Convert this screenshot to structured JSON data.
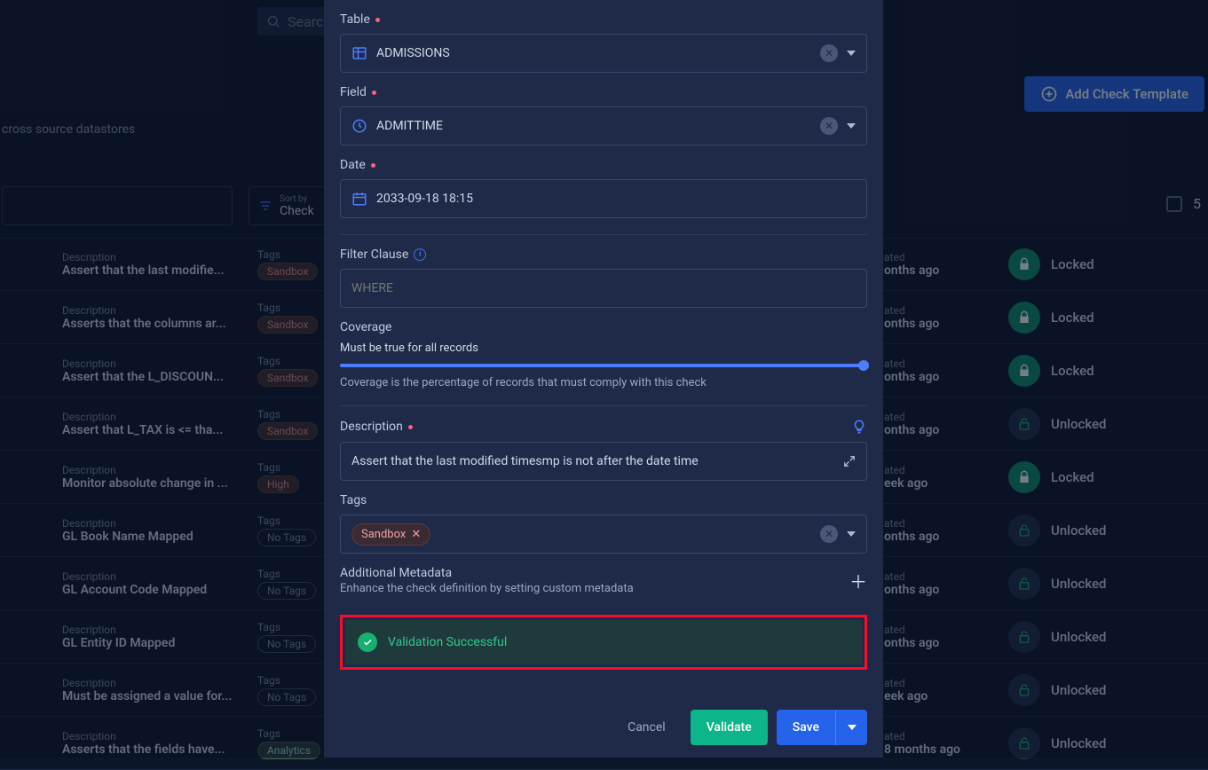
{
  "background": {
    "search_placeholder": "Searc",
    "subtitle": "cross source datastores",
    "add_template_label": "Add Check Template",
    "sort_label_small": "Sort by",
    "sort_label_value": "Check",
    "count_partial": "5",
    "rows": [
      {
        "desc_label": "Description",
        "desc": "Assert that the last modifie...",
        "tags_label": "Tags",
        "tag": "Sandbox",
        "tag_class": "tag-sandbox",
        "date_label": "ated",
        "date": "onths ago",
        "lock": "Locked",
        "locked": true
      },
      {
        "desc_label": "Description",
        "desc": "Asserts that the columns ar...",
        "tags_label": "Tags",
        "tag": "Sandbox",
        "tag_class": "tag-sandbox",
        "date_label": "ated",
        "date": "onths ago",
        "lock": "Locked",
        "locked": true
      },
      {
        "desc_label": "Description",
        "desc": "Assert that the L_DISCOUN...",
        "tags_label": "Tags",
        "tag": "Sandbox",
        "tag_class": "tag-sandbox",
        "date_label": "ated",
        "date": "onths ago",
        "lock": "Locked",
        "locked": true
      },
      {
        "desc_label": "Description",
        "desc": "Assert that L_TAX is <= tha...",
        "tags_label": "Tags",
        "tag": "Sandbox",
        "tag_class": "tag-sandbox",
        "date_label": "ated",
        "date": "onths ago",
        "lock": "Unlocked",
        "locked": false
      },
      {
        "desc_label": "Description",
        "desc": "Monitor absolute change in ...",
        "tags_label": "Tags",
        "tag": "High",
        "tag_class": "tag-high",
        "date_label": "ated",
        "date": "eek ago",
        "lock": "Locked",
        "locked": true
      },
      {
        "desc_label": "Description",
        "desc": "GL Book Name Mapped",
        "tags_label": "Tags",
        "tag": "No Tags",
        "tag_class": "tag-none",
        "date_label": "ated",
        "date": "onths ago",
        "lock": "Unlocked",
        "locked": false
      },
      {
        "desc_label": "Description",
        "desc": "GL Account Code Mapped",
        "tags_label": "Tags",
        "tag": "No Tags",
        "tag_class": "tag-none",
        "date_label": "ated",
        "date": "onths ago",
        "lock": "Unlocked",
        "locked": false
      },
      {
        "desc_label": "Description",
        "desc": "GL Entity ID Mapped",
        "tags_label": "Tags",
        "tag": "No Tags",
        "tag_class": "tag-none",
        "date_label": "ated",
        "date": "onths ago",
        "lock": "Unlocked",
        "locked": false
      },
      {
        "desc_label": "Description",
        "desc": "Must be assigned a value for...",
        "tags_label": "Tags",
        "tag": "No Tags",
        "tag_class": "tag-none",
        "date_label": "ated",
        "date": "eek ago",
        "lock": "Unlocked",
        "locked": false
      },
      {
        "desc_label": "Description",
        "desc": "Asserts that the fields have...",
        "tags_label": "Tags",
        "tag": "Analytics",
        "tag_class": "tag-analytics",
        "date_label": "ated",
        "date": "8 months ago",
        "lock": "Unlocked",
        "locked": false
      }
    ]
  },
  "modal": {
    "table_label": "Table",
    "table_value": "ADMISSIONS",
    "field_label": "Field",
    "field_value": "ADMITTIME",
    "date_label": "Date",
    "date_value": "2033-09-18 18:15",
    "filter_label": "Filter Clause",
    "filter_placeholder": "WHERE",
    "coverage_label": "Coverage",
    "coverage_text": "Must be true for all records",
    "coverage_helper": "Coverage is the percentage of records that must comply with this check",
    "description_label": "Description",
    "description_value": "Assert that the last modified timesmp is not after the date time",
    "tags_label": "Tags",
    "tag_value": "Sandbox",
    "metadata_label": "Additional Metadata",
    "metadata_helper": "Enhance the check definition by setting custom metadata",
    "validation_text": "Validation Successful",
    "cancel_label": "Cancel",
    "validate_label": "Validate",
    "save_label": "Save"
  }
}
